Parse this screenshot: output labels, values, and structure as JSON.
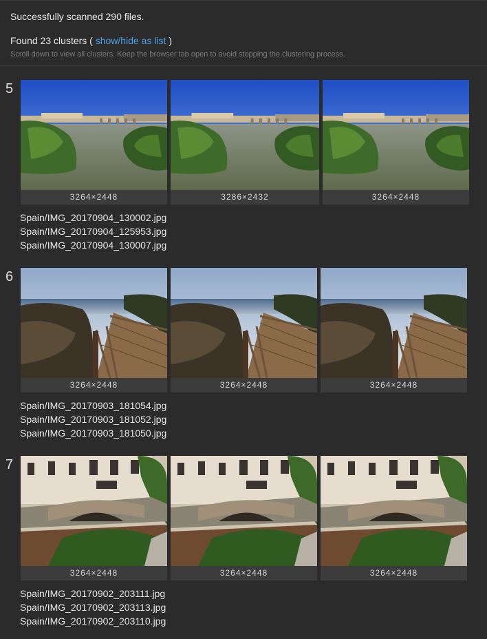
{
  "header": {
    "status": "Successfully scanned 290 files.",
    "found_prefix": "Found 23 clusters (",
    "toggle_link": "show/hide as list",
    "found_suffix": ")",
    "hint": "Scroll down to view all clusters. Keep the browser tab open to avoid stopping the clustering process."
  },
  "clusters": [
    {
      "number": "5",
      "images": [
        {
          "dimensions": "3264×2448",
          "scene": "river"
        },
        {
          "dimensions": "3286×2432",
          "scene": "river"
        },
        {
          "dimensions": "3264×2448",
          "scene": "river"
        }
      ],
      "files": [
        "Spain/IMG_20170904_130002.jpg",
        "Spain/IMG_20170904_125953.jpg",
        "Spain/IMG_20170904_130007.jpg"
      ]
    },
    {
      "number": "6",
      "images": [
        {
          "dimensions": "3264×2448",
          "scene": "boardwalk"
        },
        {
          "dimensions": "3264×2448",
          "scene": "boardwalk"
        },
        {
          "dimensions": "3264×2448",
          "scene": "boardwalk"
        }
      ],
      "files": [
        "Spain/IMG_20170903_181054.jpg",
        "Spain/IMG_20170903_181052.jpg",
        "Spain/IMG_20170903_181050.jpg"
      ]
    },
    {
      "number": "7",
      "images": [
        {
          "dimensions": "3264×2448",
          "scene": "bridge"
        },
        {
          "dimensions": "3264×2448",
          "scene": "bridge"
        },
        {
          "dimensions": "3264×2448",
          "scene": "bridge"
        }
      ],
      "files": [
        "Spain/IMG_20170902_203111.jpg",
        "Spain/IMG_20170902_203113.jpg",
        "Spain/IMG_20170902_203110.jpg"
      ]
    }
  ],
  "colors": {
    "background": "#2b2b2b",
    "link": "#4ea3e8",
    "hint": "#7d7d7d"
  }
}
